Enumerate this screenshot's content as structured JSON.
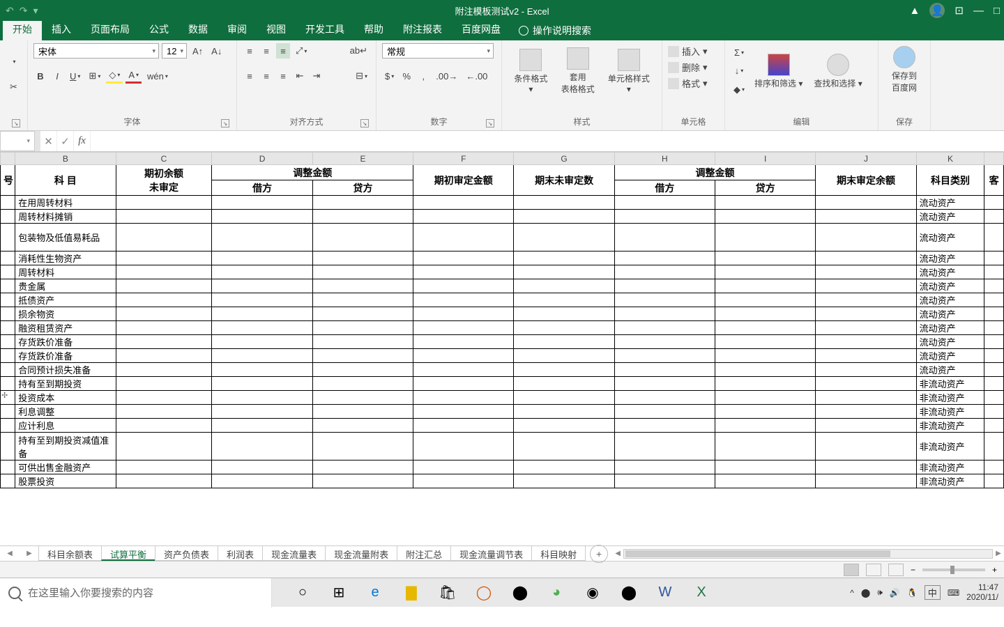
{
  "titlebar": {
    "title": "附注模板测试v2 - Excel"
  },
  "tabs": [
    "开始",
    "插入",
    "页面布局",
    "公式",
    "数据",
    "审阅",
    "视图",
    "开发工具",
    "帮助",
    "附注报表",
    "百度网盘"
  ],
  "tell_me": "操作说明搜索",
  "ribbon": {
    "font_name": "宋体",
    "font_size": "12",
    "group_font": "字体",
    "group_align": "对齐方式",
    "group_number": "数字",
    "number_format": "常规",
    "group_styles": "样式",
    "cond_fmt": "条件格式",
    "table_fmt": "套用\n表格格式",
    "cell_styles": "单元格样式",
    "group_cells": "单元格",
    "insert": "插入",
    "delete": "删除",
    "format": "格式",
    "group_edit": "编辑",
    "sort_filter": "排序和筛选",
    "find_select": "查找和选择",
    "group_save": "保存",
    "save_baidu": "保存到\n百度网"
  },
  "namebox": "",
  "colheaders": [
    "B",
    "C",
    "D",
    "E",
    "F",
    "G",
    "H",
    "I",
    "J",
    "K"
  ],
  "table_headers": {
    "serial": "号",
    "subject": "科    目",
    "opening_unaudited": "期初余额\n未审定",
    "adjustment": "调整金额",
    "debit": "借方",
    "credit": "贷方",
    "opening_audited": "期初审定金额",
    "closing_unaudited": "期末未审定数",
    "closing_audited": "期末审定余额",
    "category": "科目类别",
    "client": "客"
  },
  "rows": [
    {
      "subject": "在用周转材料",
      "category": "流动资产"
    },
    {
      "subject": "周转材料摊销",
      "category": "流动资产"
    },
    {
      "subject": "包装物及低值易耗品",
      "category": "流动资产",
      "tall": true
    },
    {
      "subject": "消耗性生物资产",
      "category": "流动资产"
    },
    {
      "subject": "周转材料",
      "category": "流动资产"
    },
    {
      "subject": "贵金属",
      "category": "流动资产"
    },
    {
      "subject": "抵债资产",
      "category": "流动资产"
    },
    {
      "subject": "损余物资",
      "category": "流动资产"
    },
    {
      "subject": "融资租赁资产",
      "category": "流动资产"
    },
    {
      "subject": "存货跌价准备",
      "category": "流动资产"
    },
    {
      "subject": "存货跌价准备",
      "category": "流动资产"
    },
    {
      "subject": "合同预计损失准备",
      "category": "流动资产"
    },
    {
      "subject": "持有至到期投资",
      "category": "非流动资产"
    },
    {
      "subject": "投资成本",
      "category": "非流动资产"
    },
    {
      "subject": "利息调整",
      "category": "非流动资产"
    },
    {
      "subject": "应计利息",
      "category": "非流动资产"
    },
    {
      "subject": "持有至到期投资减值准备",
      "category": "非流动资产",
      "tall": true
    },
    {
      "subject": "可供出售金融资产",
      "category": "非流动资产"
    },
    {
      "subject": "股票投资",
      "category": "非流动资产"
    }
  ],
  "sheets": [
    "科目余额表",
    "试算平衡",
    "资产负债表",
    "利润表",
    "现金流量表",
    "现金流量附表",
    "附注汇总",
    "现金流量调节表",
    "科目映射"
  ],
  "active_sheet": 1,
  "taskbar": {
    "search_placeholder": "在这里输入你要搜索的内容",
    "ime": "中",
    "time": "11:47",
    "date": "2020/11/"
  }
}
